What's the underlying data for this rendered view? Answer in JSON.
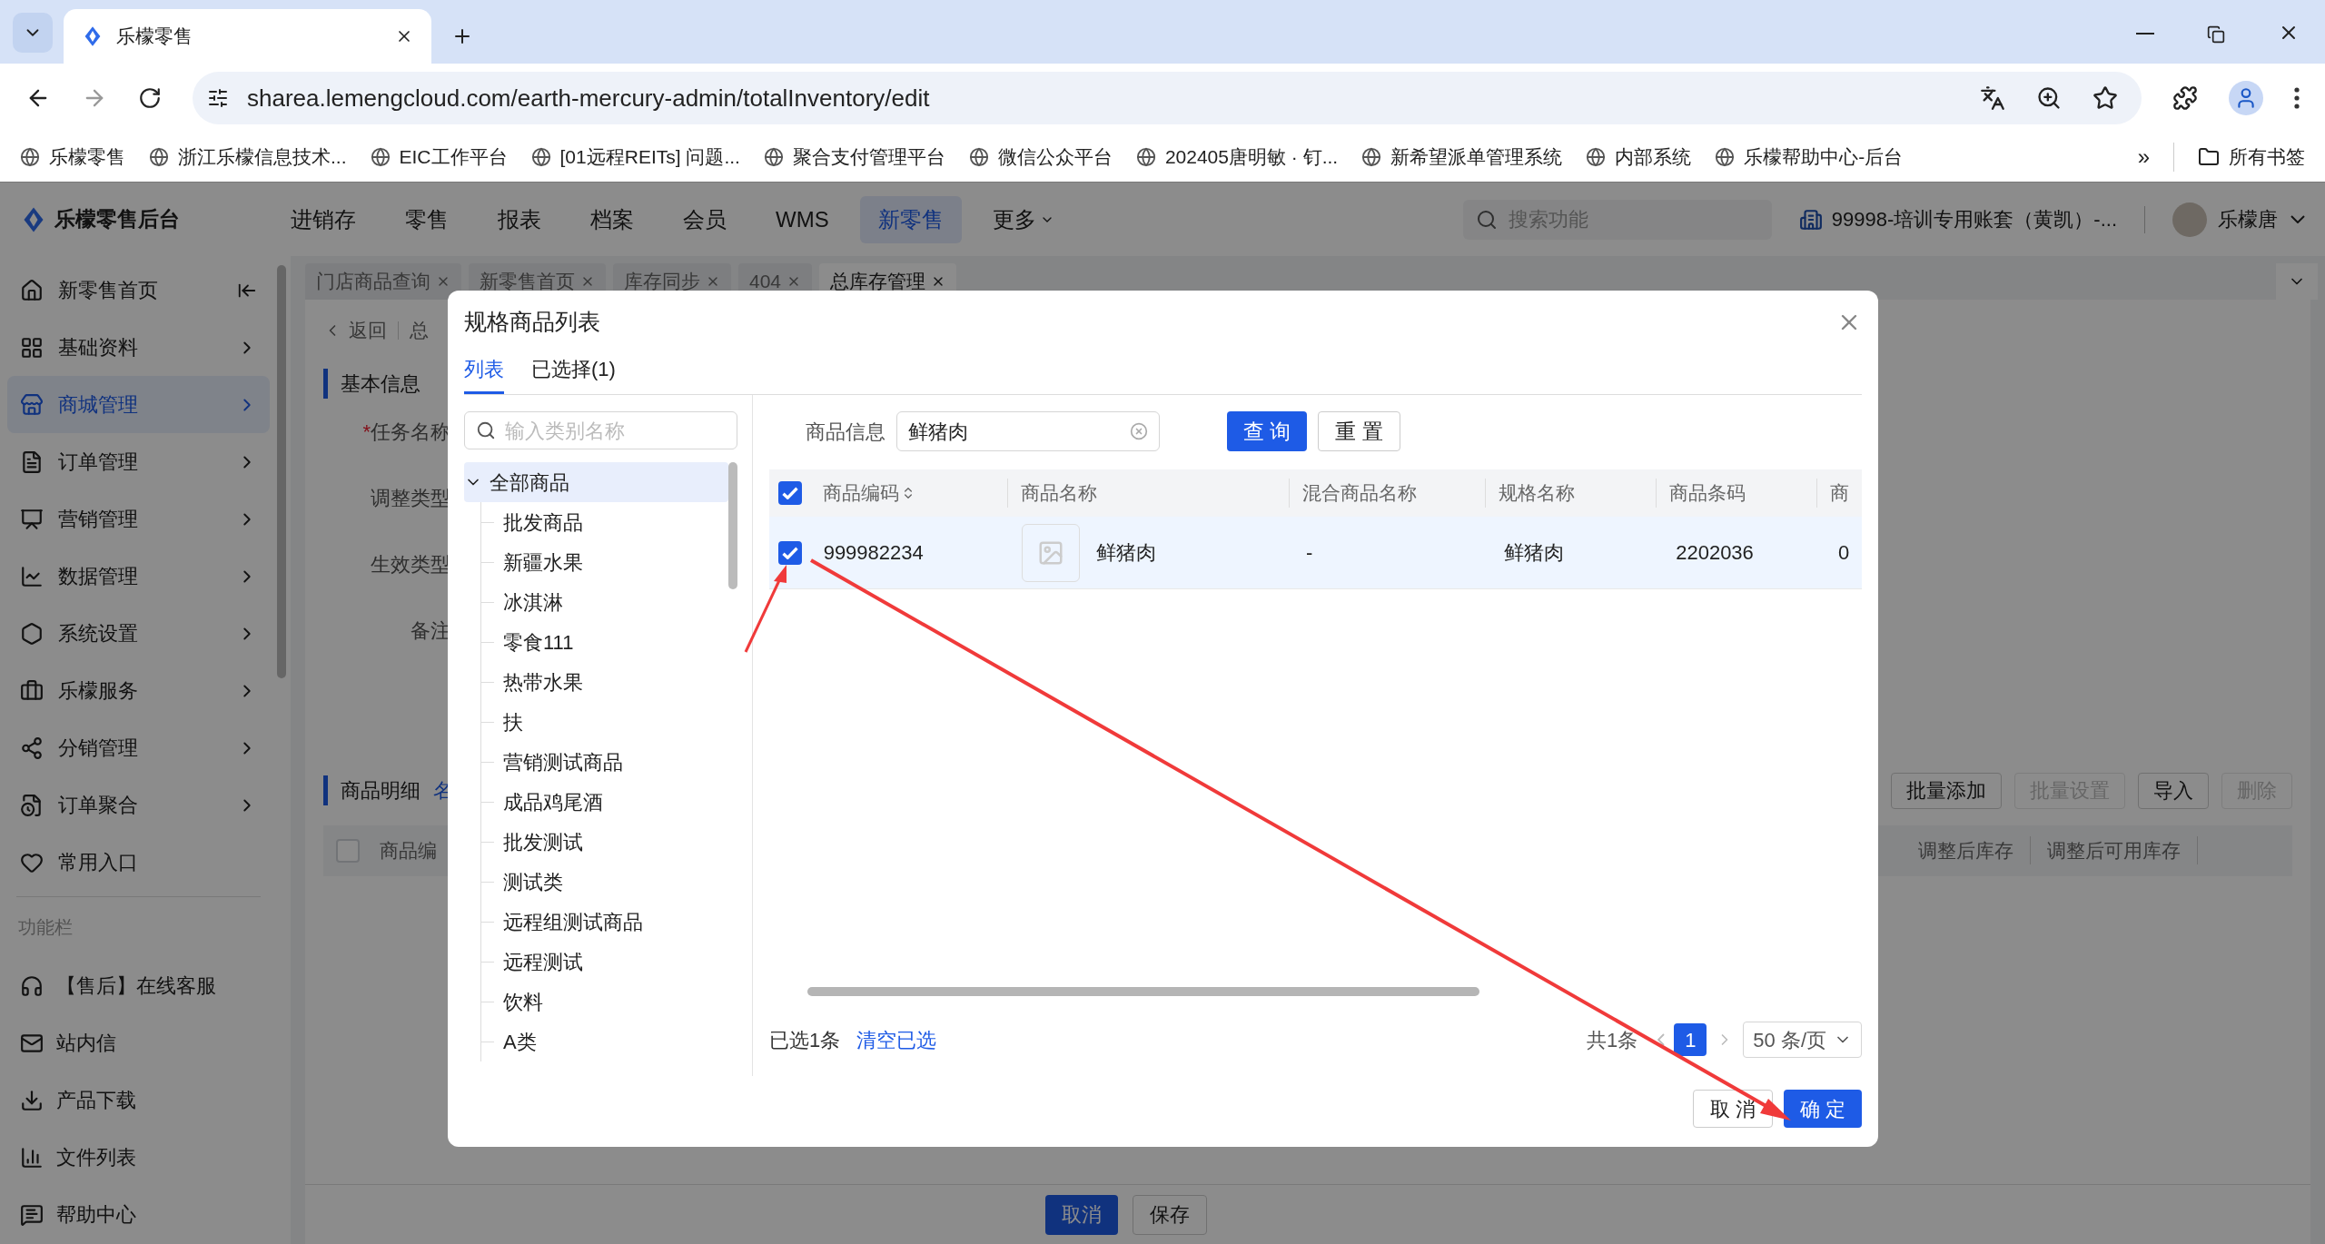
{
  "browser": {
    "tab_title": "乐檬零售",
    "url": "sharea.lemengcloud.com/earth-mercury-admin/totalInventory/edit",
    "bookmarks": [
      "乐檬零售",
      "浙江乐檬信息技术...",
      "EIC工作平台",
      "[01远程REITs] 问题...",
      "聚合支付管理平台",
      "微信公众平台",
      "202405唐明敏 · 钉...",
      "新希望派单管理系统",
      "内部系统",
      "乐檬帮助中心-后台"
    ],
    "more_bookmarks": "»",
    "all_bookmarks": "所有书签"
  },
  "header": {
    "logo": "乐檬零售后台",
    "nav": [
      {
        "label": "进销存",
        "selected": false
      },
      {
        "label": "零售",
        "selected": false
      },
      {
        "label": "报表",
        "selected": false
      },
      {
        "label": "档案",
        "selected": false
      },
      {
        "label": "会员",
        "selected": false
      },
      {
        "label": "WMS",
        "selected": false
      },
      {
        "label": "新零售",
        "selected": true
      },
      {
        "label": "更多",
        "selected": false
      }
    ],
    "search_placeholder": "搜索功能",
    "account": "99998-培训专用账套（黄凯）-...",
    "user": "乐檬唐"
  },
  "sidebar": {
    "items": [
      {
        "label": "新零售首页",
        "selected": false
      },
      {
        "label": "基础资料",
        "selected": false
      },
      {
        "label": "商城管理",
        "selected": true
      },
      {
        "label": "订单管理",
        "selected": false
      },
      {
        "label": "营销管理",
        "selected": false
      },
      {
        "label": "数据管理",
        "selected": false
      },
      {
        "label": "系统设置",
        "selected": false
      },
      {
        "label": "乐檬服务",
        "selected": false
      },
      {
        "label": "分销管理",
        "selected": false
      },
      {
        "label": "订单聚合",
        "selected": false
      },
      {
        "label": "常用入口",
        "selected": false
      }
    ],
    "section_title": "功能栏",
    "tools": [
      "【售后】在线客服",
      "站内信",
      "产品下载",
      "文件列表",
      "帮助中心"
    ]
  },
  "page_tabs": [
    {
      "label": "门店商品查询",
      "selected": false
    },
    {
      "label": "新零售首页",
      "selected": false
    },
    {
      "label": "库存同步",
      "selected": false
    },
    {
      "label": "404",
      "selected": false
    },
    {
      "label": "总库存管理",
      "selected": true
    }
  ],
  "page": {
    "back": "返回",
    "required_mark": "*",
    "select_all_checked": false,
    "breadcrumb": "总",
    "section_basic": "基本信息",
    "fields": [
      {
        "label": "任务名称",
        "required": true
      },
      {
        "label": "调整类型",
        "required": false
      },
      {
        "label": "生效类型",
        "required": false
      },
      {
        "label": "备注",
        "required": false
      }
    ],
    "section_items": "商品明细",
    "section_link": "名",
    "actions": [
      {
        "label": "批量添加",
        "disabled": false
      },
      {
        "label": "批量设置",
        "disabled": true
      },
      {
        "label": "导入",
        "disabled": false
      },
      {
        "label": "删除",
        "disabled": true
      }
    ],
    "columns": [
      "商品编",
      "调整后库存",
      "调整后可用库存"
    ],
    "buttons": [
      {
        "label": "取消",
        "primary": true
      },
      {
        "label": "保存",
        "primary": false
      }
    ]
  },
  "dialog": {
    "title": "规格商品列表",
    "tabs": [
      {
        "label": "列表",
        "selected": true
      },
      {
        "label": "已选择(1)",
        "selected": false
      }
    ],
    "category_search_placeholder": "输入类别名称",
    "tree": [
      {
        "label": "全部商品",
        "expanded": true,
        "selected": true,
        "children": [
          {
            "label": "批发商品",
            "selected": false
          },
          {
            "label": "新疆水果",
            "selected": false
          },
          {
            "label": "冰淇淋",
            "selected": false
          },
          {
            "label": "零食111",
            "selected": false
          },
          {
            "label": "热带水果",
            "selected": false
          },
          {
            "label": "扶",
            "selected": false
          },
          {
            "label": "营销测试商品",
            "selected": false
          },
          {
            "label": "成品鸡尾酒",
            "selected": false
          },
          {
            "label": "批发测试",
            "selected": false
          },
          {
            "label": "测试类",
            "selected": false
          },
          {
            "label": "远程组测试商品",
            "selected": false
          },
          {
            "label": "远程测试",
            "selected": false
          },
          {
            "label": "饮料",
            "selected": false
          },
          {
            "label": "A类",
            "selected": false
          }
        ]
      }
    ],
    "filter": {
      "label": "商品信息",
      "value": "鲜猪肉"
    },
    "query_button": "查 询",
    "reset_button": "重 置",
    "select_all_checked": true,
    "columns": [
      {
        "label": "商品编码",
        "sortable": true
      },
      {
        "label": "商品名称",
        "sortable": false
      },
      {
        "label": "混合商品名称",
        "sortable": false
      },
      {
        "label": "规格名称",
        "sortable": false
      },
      {
        "label": "商品条码",
        "sortable": false
      },
      {
        "label": "商",
        "sortable": false
      }
    ],
    "rows": [
      {
        "checked": true,
        "selected": true,
        "cells": [
          "999982234",
          "鲜猪肉",
          "-",
          "鲜猪肉",
          "2202036",
          "0"
        ]
      }
    ],
    "selected_count": "已选1条",
    "clear_link": "清空已选",
    "total": "共1条",
    "pages": [
      {
        "label": "1",
        "selected": true
      }
    ],
    "page_size": "50 条/页",
    "cancel": "取 消",
    "confirm": "确 定"
  }
}
